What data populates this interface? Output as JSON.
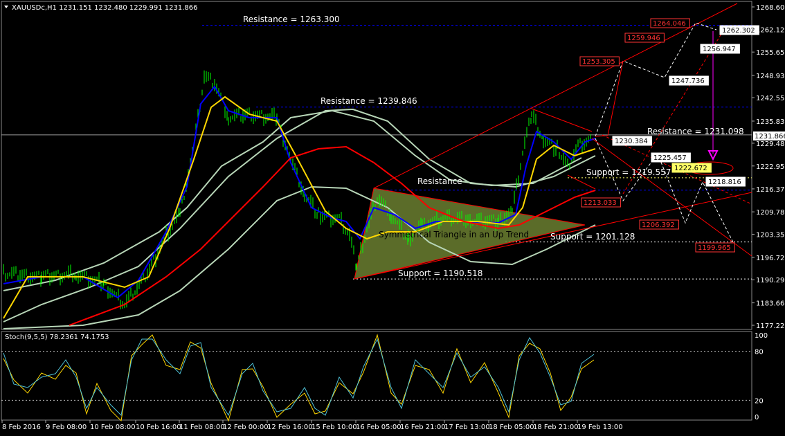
{
  "header": {
    "symbol_line": "XAUUSDc,H1  1231.151 1232.480 1229.991 1231.866"
  },
  "chart_data": {
    "type": "line",
    "symbol": "XAUUSDc",
    "timeframe": "H1",
    "ohlc": {
      "open": 1231.151,
      "high": 1232.48,
      "low": 1229.991,
      "close": 1231.866
    },
    "current_price_label": "1231.866",
    "ylim": [
      1175.5,
      1270.5
    ],
    "x_ticks": [
      "8 Feb 2016",
      "9 Feb 08:00",
      "10 Feb 08:00",
      "10 Feb 16:00",
      "11 Feb 08:00",
      "12 Feb 00:00",
      "12 Feb 16:00",
      "15 Feb 10:00",
      "16 Feb 05:00",
      "16 Feb 21:00",
      "17 Feb 13:00",
      "18 Feb 05:00",
      "18 Feb 21:00",
      "19 Feb 13:00"
    ],
    "y_ticks": [
      "1268.600",
      "1262.125",
      "1255.650",
      "1248.935",
      "1242.550",
      "1235.830",
      "1229.485",
      "1222.950",
      "1216.370",
      "1209.780",
      "1203.355",
      "1196.725",
      "1190.290",
      "1183.660",
      "1177.225"
    ],
    "y_tick_values": [
      1268.6,
      1262.125,
      1255.65,
      1248.935,
      1242.55,
      1235.83,
      1229.485,
      1222.95,
      1216.37,
      1209.78,
      1203.355,
      1196.725,
      1190.29,
      1183.66,
      1177.225
    ],
    "annotations": {
      "resistance_1": "Resistance = 1263.300",
      "resistance_2": "Resistance = 1239.846",
      "resistance_3": "Resistance",
      "resistance_4": "Resistance = 1231.098",
      "support_1": "Support = 1190.518",
      "support_2": "Support = 1201.128",
      "support_3": "Support = 1219.557",
      "pattern": "Symmetrical Triangle in an Up Trend"
    },
    "projection_labels_red": [
      "1264.046",
      "1259.946",
      "1253.305",
      "1213.033",
      "1206.392",
      "1199.965"
    ],
    "projection_labels_white": [
      "1262.302",
      "1256.947",
      "1247.736",
      "1230.384",
      "1225.457",
      "1218.816"
    ],
    "projection_label_yellow": "1222.672",
    "key_levels": [
      1263.3,
      1239.846,
      1231.098,
      1219.557,
      1216.0,
      1201.128,
      1190.518
    ],
    "colors": {
      "background": "#000000",
      "candles": "#00ff00",
      "ma_fast": "#0000ff",
      "ma_medium": "#ffd700",
      "ma_slow": "#ff0000",
      "bollinger": "#b7d5b7",
      "triangle_fill": "#6b7f30",
      "trend_lines": "#ff0000",
      "level_lines": "#0000ff",
      "stoch_main": "#4fc3d9",
      "stoch_signal": "#ffd700",
      "projection_arrow": "#ff00ff"
    }
  },
  "stochastic": {
    "label": "Stoch(9,5,5) 78.2361 74.1753",
    "params": "9,5,5",
    "main": 78.2361,
    "signal": 74.1753,
    "levels": [
      "100",
      "80",
      "20",
      "0"
    ],
    "level_values": [
      100,
      80,
      20,
      0
    ]
  }
}
